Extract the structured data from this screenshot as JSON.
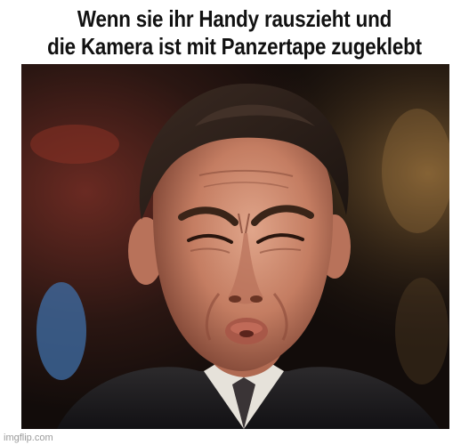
{
  "caption": {
    "line1": "Wenn sie ihr Handy rauszieht und",
    "line2": "die Kamera ist mit Panzertape zugeklebt"
  },
  "watermark": "imgflip.com"
}
